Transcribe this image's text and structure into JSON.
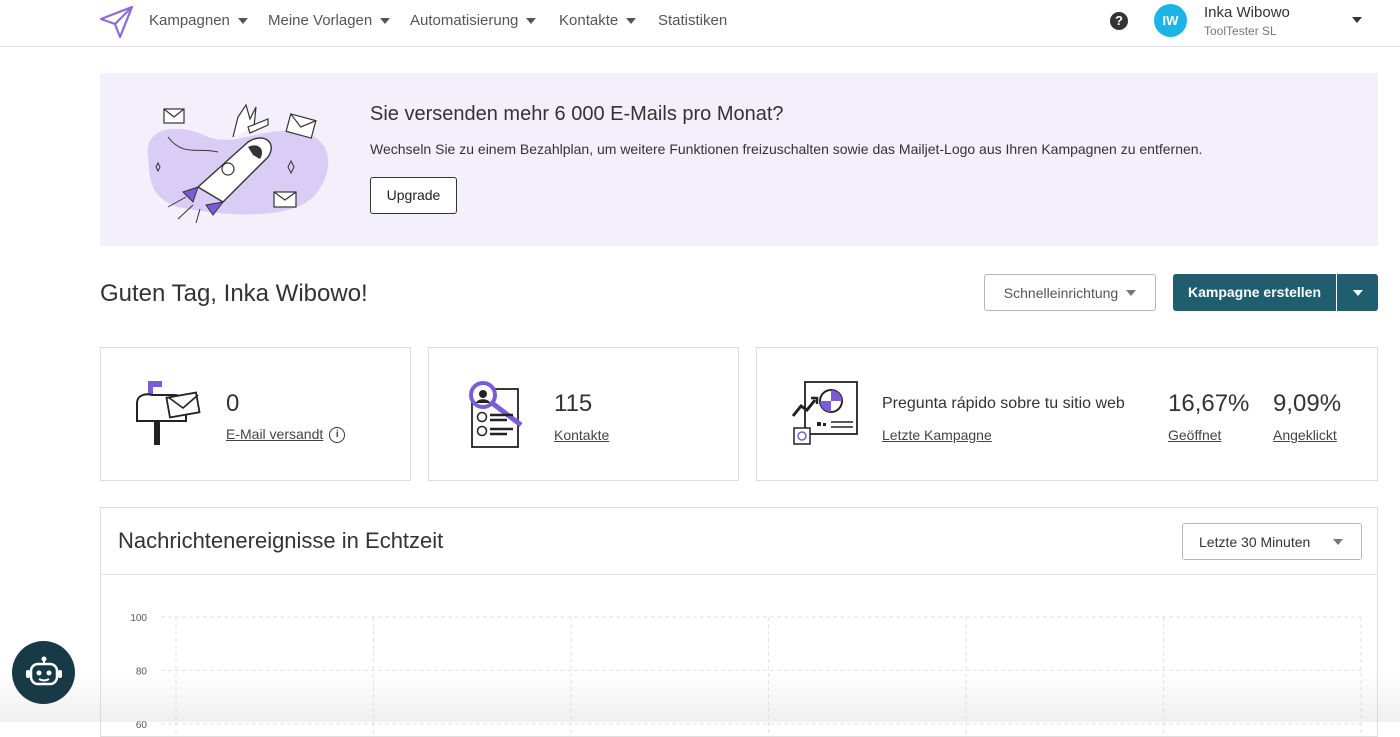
{
  "nav": {
    "items": [
      {
        "label": "Kampagnen",
        "has_caret": true
      },
      {
        "label": "Meine Vorlagen",
        "has_caret": true
      },
      {
        "label": "Automatisierung",
        "has_caret": true
      },
      {
        "label": "Kontakte",
        "has_caret": true
      },
      {
        "label": "Statistiken",
        "has_caret": false
      }
    ],
    "help_symbol": "?",
    "user": {
      "initials": "IW",
      "name": "Inka Wibowo",
      "org": "ToolTester SL"
    }
  },
  "banner": {
    "title": "Sie versenden mehr 6 000 E-Mails pro Monat?",
    "text": "Wechseln Sie zu einem Bezahlplan, um weitere Funktionen freizuschalten sowie das Mailjet-Logo aus Ihren Kampagnen zu entfernen.",
    "button": "Upgrade"
  },
  "greeting": "Guten Tag, Inka Wibowo!",
  "actions": {
    "quick_setup": "Schnelleinrichtung",
    "create_campaign": "Kampagne erstellen"
  },
  "stats": {
    "sent": {
      "value": "0",
      "label": "E-Mail versandt",
      "info": "i"
    },
    "contacts": {
      "value": "115",
      "label": "Kontakte"
    },
    "last_campaign": {
      "name": "Pregunta rápido sobre tu sitio web",
      "label": "Letzte Kampagne",
      "opened_value": "16,67%",
      "opened_label": "Geöffnet",
      "clicked_value": "9,09%",
      "clicked_label": "Angeklickt"
    }
  },
  "realtime": {
    "title": "Nachrichtenereignisse in Echtzeit",
    "range": "Letzte 30 Minuten"
  },
  "chart_data": {
    "type": "line",
    "y_ticks": [
      "100",
      "80",
      "60"
    ],
    "ylim": [
      0,
      100
    ],
    "grid": true,
    "series": []
  },
  "colors": {
    "primary": "#1e5e6e",
    "accent": "#7c5cd6",
    "banner_bg": "#f3f0fc",
    "avatar": "#1cb3e6"
  }
}
